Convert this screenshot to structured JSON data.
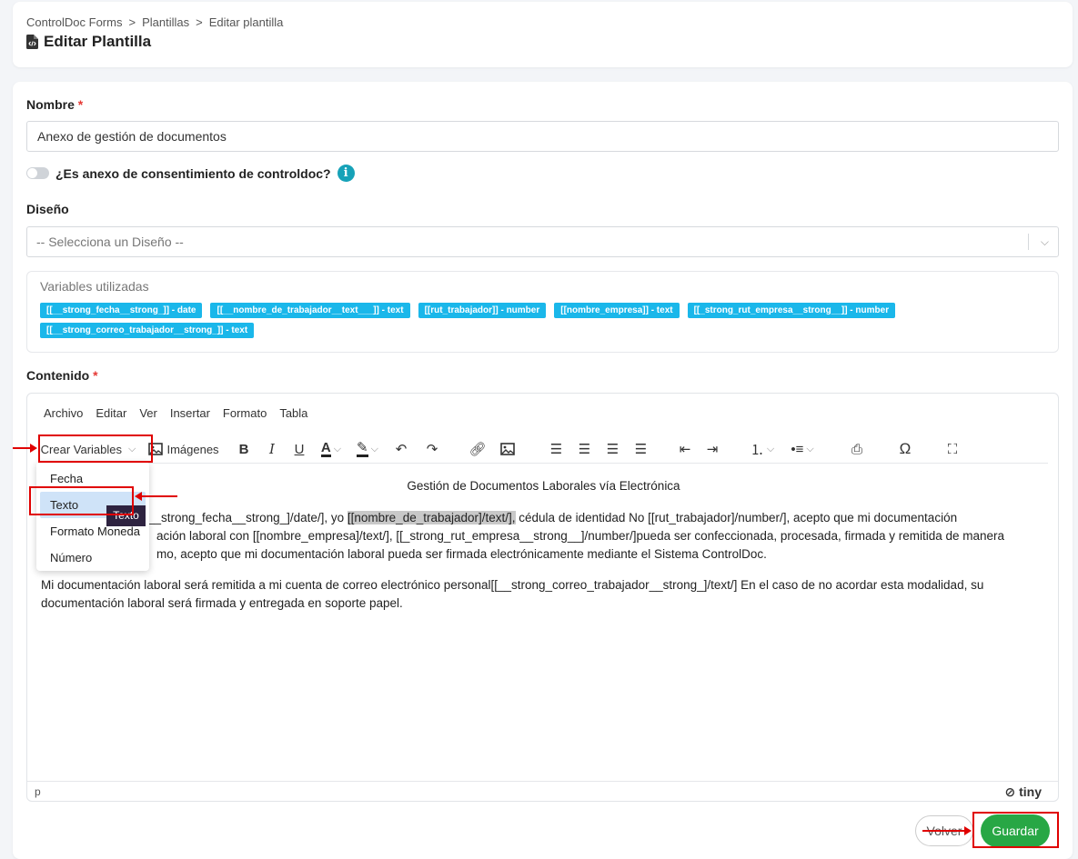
{
  "breadcrumb": [
    "ControlDoc Forms",
    "Plantillas",
    "Editar plantilla"
  ],
  "breadcrumb_sep": ">",
  "page_title": "Editar Plantilla",
  "form": {
    "nombre_label": "Nombre",
    "required_mark": "*",
    "nombre_value": "Anexo de gestión de documentos",
    "toggle_label": "¿Es anexo de consentimiento de controldoc?",
    "toggle_on": false,
    "info_icon": "i",
    "diseno_label": "Diseño",
    "diseno_placeholder": "-- Selecciona un Diseño --",
    "contenido_label": "Contenido"
  },
  "variables": {
    "title": "Variables utilizadas",
    "chips": [
      "[[__strong_fecha__strong_]] - date",
      "[[__nombre_de_trabajador__text___]] - text",
      "[[rut_trabajador]] - number",
      "[[nombre_empresa]] - text",
      "[[_strong_rut_empresa__strong__]] - number",
      "[[__strong_correo_trabajador__strong_]] - text"
    ],
    "chip_color": "#1ab7ea"
  },
  "editor": {
    "menu": [
      "Archivo",
      "Editar",
      "Ver",
      "Insertar",
      "Formato",
      "Tabla"
    ],
    "crear_variables": "Crear Variables",
    "imagenes": "Imágenes",
    "dropdown_items": [
      "Fecha",
      "Texto",
      "Formato Moneda",
      "Número"
    ],
    "tooltip": "Texto",
    "content": {
      "title": "Gestión de Documentos Laborales vía Electrónica",
      "p1_part1": "__strong_fecha__strong_]/date/], yo ",
      "p1_highlight": "[[nombre_de_trabajador]/text/],",
      "p1_part2": " cédula de identidad No [[rut_trabajador]/number/], acepto que mi documentación",
      "p1_line2": "ación laboral con [[nombre_empresa]/text/], [[_strong_rut_empresa__strong__]/number/]pueda ser confeccionada, procesada, firmada y remitida de manera",
      "p1_line3": "mo, acepto que mi documentación laboral pueda ser firmada electrónicamente mediante el Sistema ControlDoc.",
      "p2": "Mi documentación laboral será remitida a mi cuenta de correo electrónico personal[[__strong_correo_trabajador__strong_]/text/] En el caso de no acordar esta modalidad, su documentación laboral será firmada y entregada en soporte papel."
    },
    "status_path": "p",
    "brand": "tiny"
  },
  "buttons": {
    "volver": "Volver",
    "guardar": "Guardar"
  },
  "colors": {
    "accent_green": "#28a745",
    "annotation_red": "#e00000",
    "info_teal": "#17a2b8"
  }
}
